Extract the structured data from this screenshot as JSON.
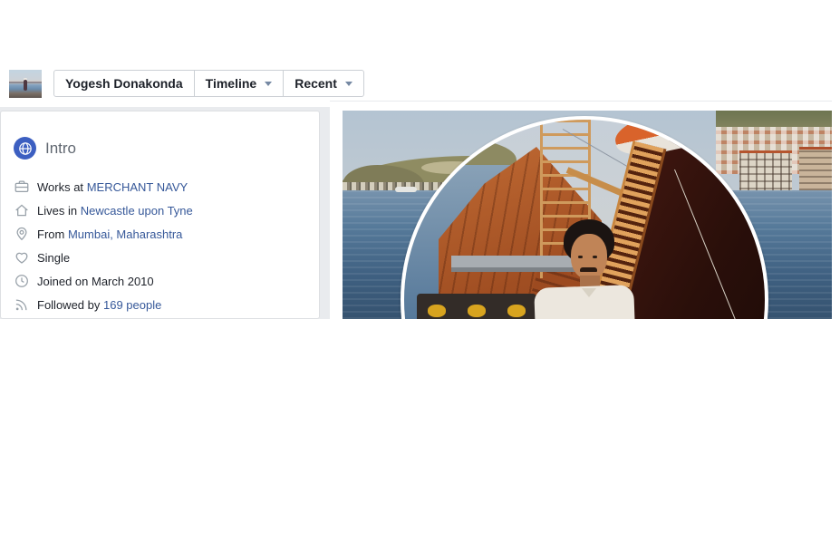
{
  "profile_bar": {
    "name": "Yogesh Donakonda",
    "timeline_label": "Timeline",
    "sort_label": "Recent"
  },
  "intro": {
    "heading": "Intro",
    "rows": [
      {
        "icon": "briefcase-icon",
        "prefix": "Works at",
        "link": "MERCHANT NAVY"
      },
      {
        "icon": "home-icon",
        "prefix": "Lives in",
        "link": "Newcastle upon Tyne"
      },
      {
        "icon": "location-pin-icon",
        "prefix": "From",
        "link": "Mumbai, Maharashtra"
      },
      {
        "icon": "heart-icon",
        "text": "Single"
      },
      {
        "icon": "clock-icon",
        "text": "Joined on March 2010"
      },
      {
        "icon": "follow-waves-icon",
        "prefix": "Followed by",
        "link": "169 people"
      }
    ]
  },
  "colors": {
    "link": "#365899",
    "body_text": "#1d2129",
    "intro_heading": "#606770",
    "intro_badge_blue": "#3c5fc1",
    "page_band": "#e9ebee",
    "card_border": "#dddfe2",
    "button_border": "#ccd0d5"
  }
}
